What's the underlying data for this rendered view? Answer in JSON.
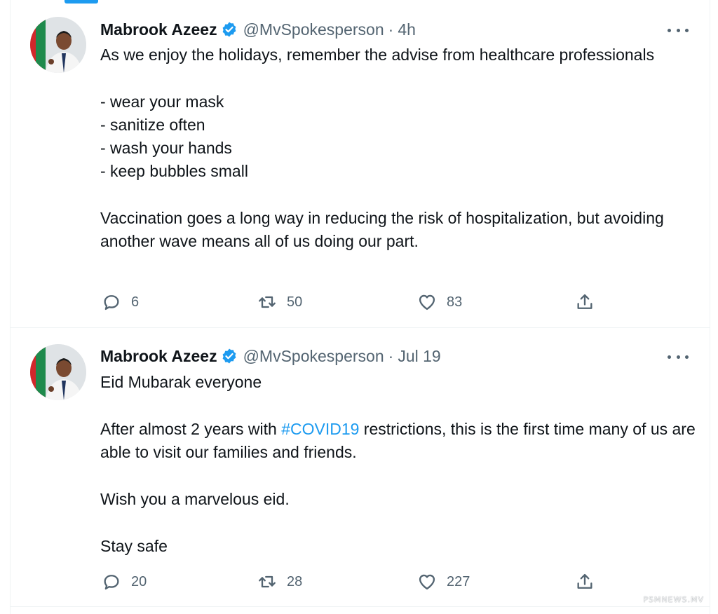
{
  "tweets": [
    {
      "author": {
        "name": "Mabrook Azeez",
        "handle": "@MvSpokesperson",
        "verified": true
      },
      "time": "4h",
      "separator": "·",
      "paragraphs": [
        "As we enjoy the holidays, remember the advise from healthcare professionals",
        "- wear your mask\n- sanitize often\n- wash your hands\n- keep bubbles small",
        "Vaccination goes a long way in reducing the risk of hospitalization, but avoiding another wave means all of us doing our part."
      ],
      "stats": {
        "replies": "6",
        "retweets": "50",
        "likes": "83"
      }
    },
    {
      "author": {
        "name": "Mabrook Azeez",
        "handle": "@MvSpokesperson",
        "verified": true
      },
      "time": "Jul 19",
      "separator": "·",
      "paragraphs": [
        "Eid Mubarak everyone",
        {
          "before": "After almost 2 years with ",
          "hashtag": "#COVID19",
          "after": " restrictions, this is the first time many of us are able to visit our families and friends."
        },
        "Wish you a marvelous eid.",
        "Stay safe"
      ],
      "stats": {
        "replies": "20",
        "retweets": "28",
        "likes": "227"
      }
    }
  ],
  "icons": {
    "reply": "reply-icon",
    "retweet": "retweet-icon",
    "like": "heart-icon",
    "share": "share-icon",
    "more": "more-icon",
    "verified": "verified-badge-icon"
  },
  "colors": {
    "accent": "#1d9bf0",
    "text_primary": "#0f1419",
    "text_secondary": "#536471",
    "border": "#eff3f4"
  },
  "watermark": "PSMNEWS.MV"
}
